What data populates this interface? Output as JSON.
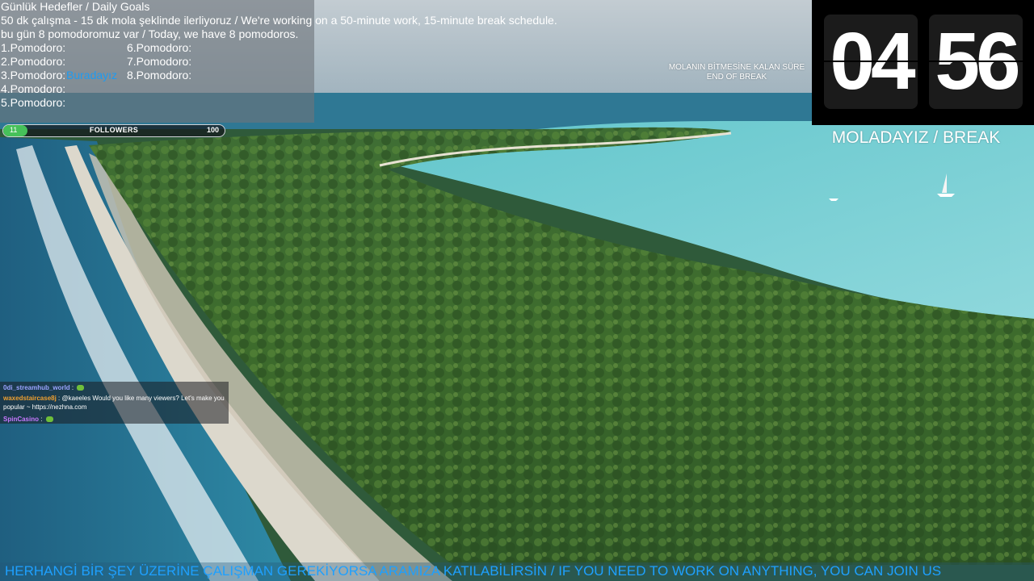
{
  "goals": {
    "title": "Günlük Hedefler / Daily Goals",
    "schedule": "50 dk çalışma - 15 dk mola şeklinde ilerliyoruz / We're working on a 50-minute work, 15-minute break schedule.",
    "today": "bu gün 8 pomodoromuz var / Today, we have 8 pomodoros.",
    "pomodoros": [
      "1.Pomodoro:",
      "2.Pomodoro:",
      "3.Pomodoro:",
      "4.Pomodoro:",
      "5.Pomodoro:",
      "6.Pomodoro:",
      "7.Pomodoro:",
      "8.Pomodoro:"
    ],
    "current_marker": "Buradayız"
  },
  "followers": {
    "label": "FOLLOWERS",
    "current": "11",
    "goal": "100",
    "progress": 0.11,
    "fill_color": "#46c15a"
  },
  "break_caption": {
    "line1": "MOLANIN BİTMESİNE KALAN SÜRE",
    "line2": "END OF BREAK"
  },
  "timer": {
    "minutes": "04",
    "seconds": "56",
    "status": "MOLADAYIZ / BREAK"
  },
  "chat": {
    "messages": [
      {
        "user": "0di_streamhub_world",
        "color": "#9aa3ff",
        "text": "",
        "emote": "frog-emote"
      },
      {
        "user": "waxedstaircase8j",
        "color": "#f0a030",
        "text": "@kaeeles Would you like many viewers? Let's make you",
        "text2": "popular ~ https://nezhna.com"
      },
      {
        "user": "SpinCasino",
        "color": "#c878ff",
        "text": "",
        "emote": "frog-emote"
      }
    ]
  },
  "ticker": {
    "text": "HERHANGİ BİR ŞEY ÜZERİNE ÇALIŞMAN GEREKİYORSA ARAMIZA KATILABİLİRSİN / IF YOU NEED TO WORK ON ANYTHING, YOU CAN JOIN US",
    "color": "#1ea0ff"
  }
}
